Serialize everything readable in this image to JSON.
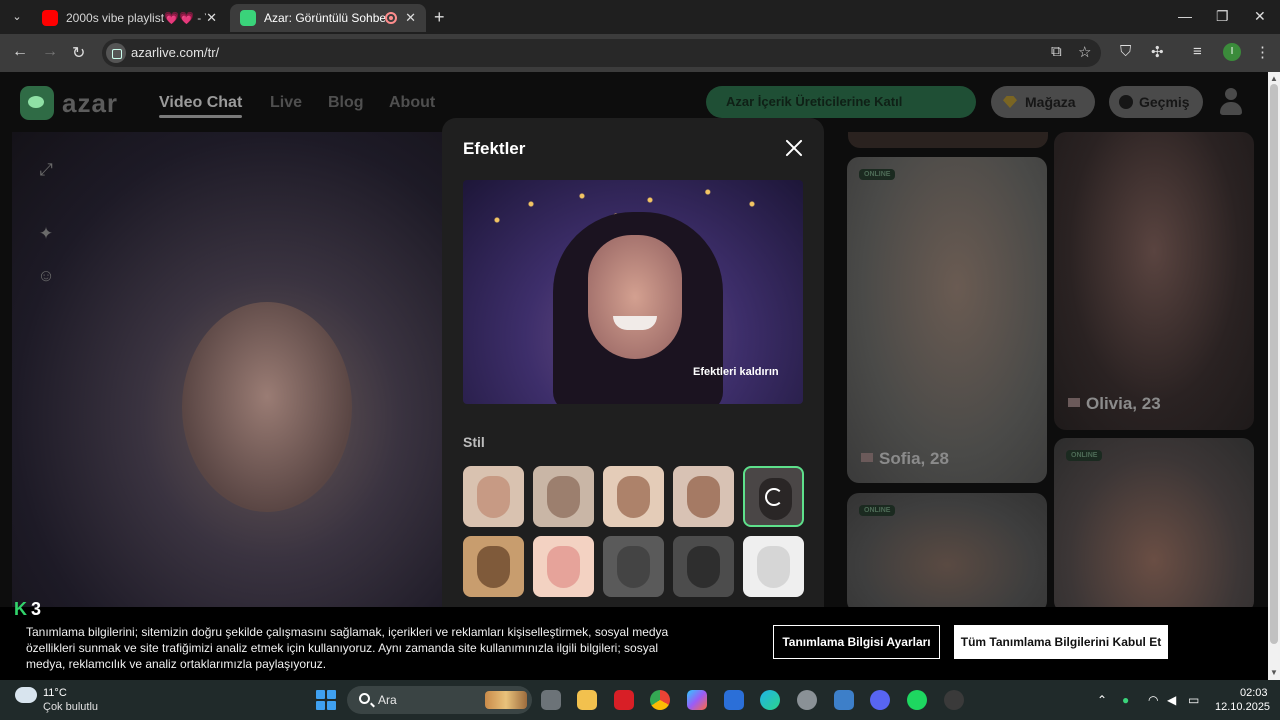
{
  "browser": {
    "tabs": [
      {
        "title": "2000s vibe playlist💗💗 - YouT",
        "favicon_color": "#ff0000"
      },
      {
        "title": "Azar: Görüntülü Sohbet, Arl",
        "favicon_color": "#3ad37a"
      }
    ],
    "url": "azarlive.com/tr/",
    "profile_initial": "I"
  },
  "site": {
    "logo": "azar",
    "nav": [
      "Video Chat",
      "Live",
      "Blog",
      "About"
    ],
    "creator_button": "Azar İçerik Üreticilerine Katıl",
    "shop_button": "Mağaza",
    "history_button": "Geçmiş"
  },
  "cards": [
    {
      "badge": "ONLINE",
      "name": "Sofia, 28"
    },
    {
      "badge": "",
      "name": "Olivia, 23"
    },
    {
      "badge": "ONLINE",
      "name": ""
    },
    {
      "badge": "ONLINE",
      "name": ""
    }
  ],
  "modal": {
    "title": "Efektler",
    "remove_button": "Efektleri kaldırın",
    "section_label": "Stil",
    "effects": [
      {
        "name": "effect-realistic-man",
        "colors": [
          "#d9c2b0",
          "#c79a84"
        ]
      },
      {
        "name": "effect-big-eyes",
        "colors": [
          "#c9b6a6",
          "#9c7f6e"
        ]
      },
      {
        "name": "effect-caricature",
        "colors": [
          "#e4ccb8",
          "#ad826a"
        ]
      },
      {
        "name": "effect-big-smile",
        "colors": [
          "#d8c2b4",
          "#a57a64"
        ]
      },
      {
        "name": "effect-dark-loading",
        "colors": [
          "#4a4646",
          "#2a2626"
        ]
      },
      {
        "name": "effect-fluffy-bunny",
        "colors": [
          "#c89d6e",
          "#7f5a3a"
        ]
      },
      {
        "name": "effect-glasses-woman",
        "colors": [
          "#f3d2c2",
          "#e6a39a"
        ]
      },
      {
        "name": "effect-hamster",
        "colors": [
          "#5a5a5a",
          "#444"
        ]
      },
      {
        "name": "effect-zebra",
        "colors": [
          "#4c4c4c",
          "#2e2e2e"
        ]
      },
      {
        "name": "effect-cartoon-monster",
        "colors": [
          "#efefef",
          "#d6d6d6"
        ]
      }
    ]
  },
  "cookie_banner": {
    "logo": "3",
    "text": "Tanımlama bilgilerini; sitemizin doğru şekilde çalışmasını sağlamak, içerikleri ve reklamları kişiselleştirmek, sosyal medya özellikleri sunmak ve site trafiğimizi analiz etmek için kullanıyoruz. Aynı zamanda site kullanımınızla ilgili bilgileri; sosyal medya, reklamcılık ve analiz ortaklarımızla paylaşıyoruz.",
    "settings_button": "Tanımlama Bilgisi Ayarları",
    "accept_button": "Tüm Tanımlama Bilgilerini Kabul Et"
  },
  "taskbar": {
    "weather_temp": "11°C",
    "weather_desc": "Çok bulutlu",
    "search_placeholder": "Ara",
    "time": "02:03",
    "date": "12.10.2025"
  }
}
